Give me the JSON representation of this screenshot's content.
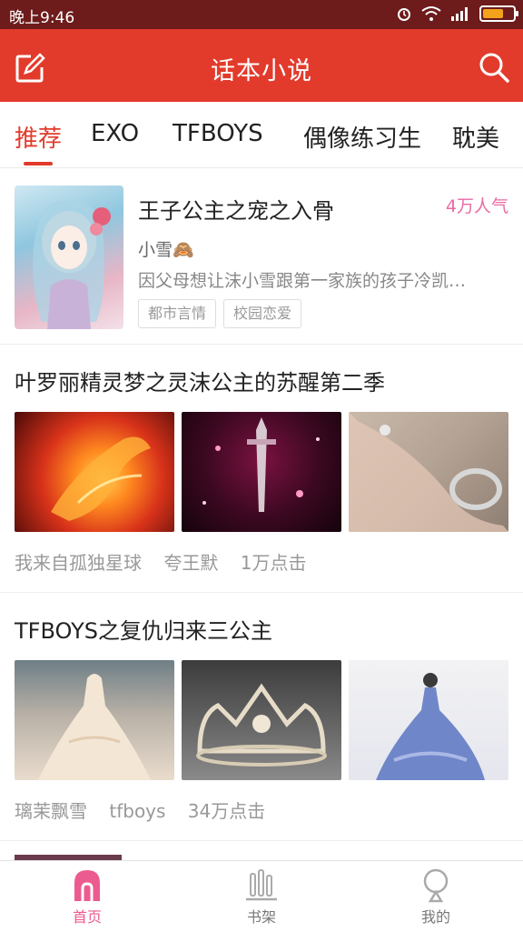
{
  "status": {
    "time": "晚上9:46"
  },
  "app": {
    "title": "话本小说"
  },
  "tabs": [
    {
      "label": "推荐",
      "active": true
    },
    {
      "label": "EXO"
    },
    {
      "label": "TFBOYS"
    },
    {
      "label": "偶像练习生"
    },
    {
      "label": "耽美"
    }
  ],
  "featured": {
    "title": "王子公主之宠之入骨",
    "popularity": "4万人气",
    "author": "小雪🙈",
    "description": "因父母想让沫小雪跟第一家族的孩子冷凯…",
    "tags": [
      "都市言情",
      "校园恋爱"
    ]
  },
  "stories": [
    {
      "title": "叶罗丽精灵梦之灵沫公主的苏醒第二季",
      "meta": [
        "我来自孤独星球",
        "夸王默",
        "1万点击"
      ]
    },
    {
      "title": "TFBOYS之复仇归来三公主",
      "meta": [
        "璃茉飘雪",
        "tfboys",
        "34万点击"
      ]
    }
  ],
  "bottom_nav": [
    {
      "label": "首页",
      "icon": "home-icon",
      "active": true
    },
    {
      "label": "书架",
      "icon": "bookshelf-icon"
    },
    {
      "label": "我的",
      "icon": "profile-icon"
    }
  ],
  "colors": {
    "brand_red": "#e23b2c",
    "active_pink": "#ec5b90",
    "popularity_pink": "#e96aa3"
  }
}
